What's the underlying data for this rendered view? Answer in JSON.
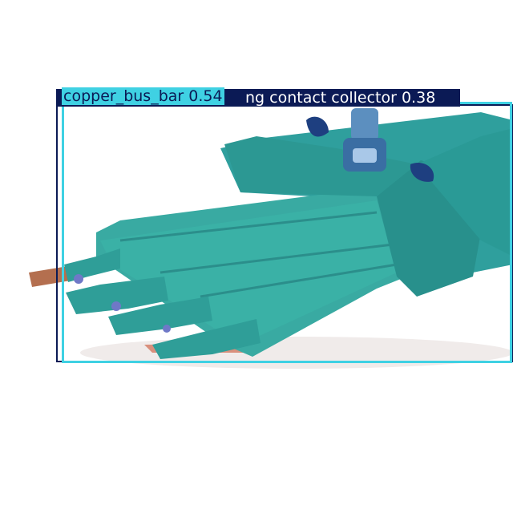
{
  "detections": [
    {
      "label": "copper_bus_bar 0.54",
      "class": "copper_bus_bar",
      "confidence": 0.54,
      "color": "#3fd1e3"
    },
    {
      "label": "ng_contact_collector 0.38",
      "class": "ng_contact_collector",
      "confidence": 0.38,
      "color": "#0b1a55",
      "note_visible_text": "ng contact collector 0.38"
    }
  ],
  "colors": {
    "mask": "#2e9a98",
    "copper": "#b46f4f",
    "background": "#ffffff"
  }
}
